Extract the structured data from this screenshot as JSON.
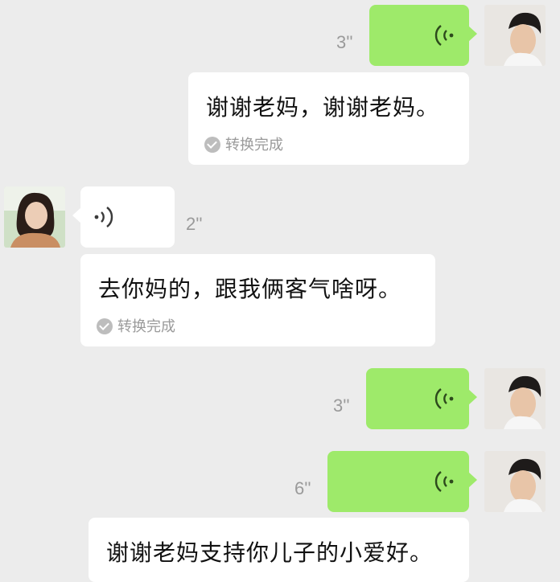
{
  "messages": [
    {
      "side": "out",
      "duration": "3''",
      "transcript": "谢谢老妈，谢谢老妈。",
      "status": "转换完成"
    },
    {
      "side": "in",
      "duration": "2''",
      "transcript": "去你妈的，跟我俩客气啥呀。",
      "status": "转换完成"
    },
    {
      "side": "out",
      "duration": "3''"
    },
    {
      "side": "out",
      "duration": "6''",
      "transcript": "谢谢老妈支持你儿子的小爱好。"
    }
  ],
  "colors": {
    "background": "#ececec",
    "outgoing_bubble": "#9eea6a",
    "incoming_bubble": "#ffffff",
    "meta_text": "#9a9a9a"
  },
  "icons": {
    "voice": "voice-wave-icon",
    "check": "check-circle-icon"
  }
}
